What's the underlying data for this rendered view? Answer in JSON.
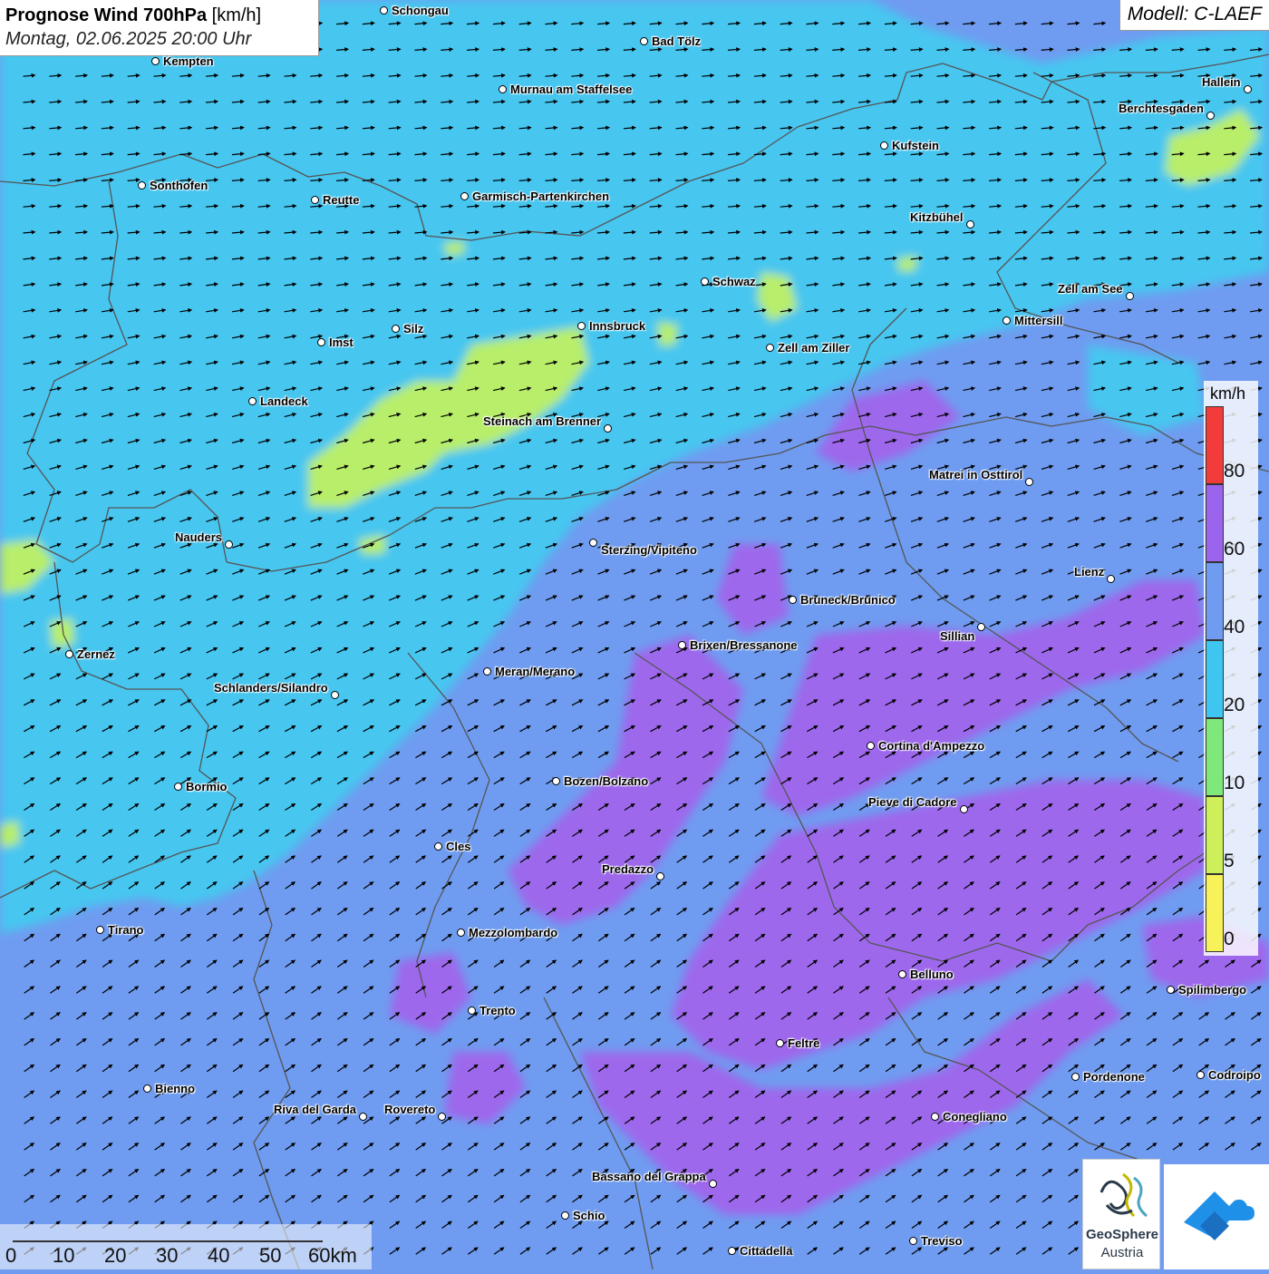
{
  "header": {
    "title_bold": "Prognose Wind 700hPa",
    "title_unit": "[km/h]",
    "date": "Montag, 02.06.2025 20:00 Uhr",
    "model": "Modell: C-LAEF"
  },
  "legend": {
    "unit": "km/h",
    "labels": [
      "80",
      "60",
      "40",
      "20",
      "10",
      "5",
      "0"
    ],
    "colors": [
      "#f23c3c",
      "#9b64ec",
      "#6f9cf0",
      "#3fc6f0",
      "#7ee87a",
      "#cdf05a",
      "#f7f25a"
    ]
  },
  "scale_bar": {
    "labels": [
      "0",
      "10",
      "20",
      "30",
      "40",
      "50",
      "60km"
    ]
  },
  "logos": {
    "geosphere_line1": "GeoSphere",
    "geosphere_line2": "Austria"
  },
  "map_colors": {
    "base": "#6f9cf0",
    "cyan": "#46c6f0",
    "purple": "#9e68ec",
    "green": "#b8ee6a",
    "border": "#555555"
  },
  "wind_direction": "from west-southwest (arrows pointing east / north-east)",
  "cities": [
    {
      "name": "Schongau"
    },
    {
      "name": "Bad Tölz"
    },
    {
      "name": "Kempten"
    },
    {
      "name": "Murnau am Staffelsee"
    },
    {
      "name": "Hallein"
    },
    {
      "name": "Berchtesgaden"
    },
    {
      "name": "Kufstein"
    },
    {
      "name": "Sonthofen"
    },
    {
      "name": "Reutte"
    },
    {
      "name": "Garmisch-Partenkirchen"
    },
    {
      "name": "Kitzbühel"
    },
    {
      "name": "Schwaz"
    },
    {
      "name": "Zell am See"
    },
    {
      "name": "Mittersill"
    },
    {
      "name": "Innsbruck"
    },
    {
      "name": "Silz"
    },
    {
      "name": "Imst"
    },
    {
      "name": "Zell am Ziller"
    },
    {
      "name": "Landeck"
    },
    {
      "name": "Steinach am Brenner"
    },
    {
      "name": "Matrei in Osttirol"
    },
    {
      "name": "Nauders"
    },
    {
      "name": "Sterzing/Vipiteno"
    },
    {
      "name": "Lienz"
    },
    {
      "name": "Bruneck/Brunico"
    },
    {
      "name": "Sillian"
    },
    {
      "name": "Brixen/Bressanone"
    },
    {
      "name": "Zernez"
    },
    {
      "name": "Meran/Merano"
    },
    {
      "name": "Schlanders/Silandro"
    },
    {
      "name": "Cortina d'Ampezzo"
    },
    {
      "name": "Bozen/Bolzano"
    },
    {
      "name": "Bormio"
    },
    {
      "name": "Pieve di Cadore"
    },
    {
      "name": "Cles"
    },
    {
      "name": "Predazzo"
    },
    {
      "name": "Tirano"
    },
    {
      "name": "Mezzolombardo"
    },
    {
      "name": "Belluno"
    },
    {
      "name": "Spilimbergo"
    },
    {
      "name": "Trento"
    },
    {
      "name": "Feltre"
    },
    {
      "name": "Pordenone"
    },
    {
      "name": "Codroipo"
    },
    {
      "name": "Bienno"
    },
    {
      "name": "Riva del Garda"
    },
    {
      "name": "Rovereto"
    },
    {
      "name": "Conegliano"
    },
    {
      "name": "Bassano del Grappa"
    },
    {
      "name": "Schio"
    },
    {
      "name": "Treviso"
    },
    {
      "name": "Cittadella"
    }
  ]
}
